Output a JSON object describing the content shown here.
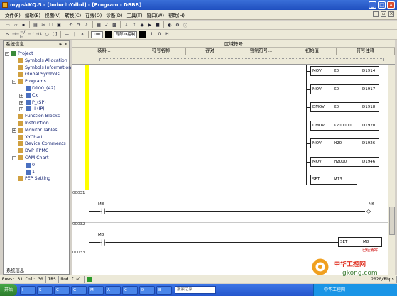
{
  "window": {
    "title": "mypskKQ.5 - [Indurlt-Ydbd] - [Program - DBBB]"
  },
  "menu": [
    "文件(F)",
    "编辑(E)",
    "视图(V)",
    "转换(C)",
    "在线(O)",
    "诊断(D)",
    "工具(T)",
    "窗口(W)",
    "帮助(H)"
  ],
  "toolbar": {
    "address_field": "100",
    "mode_label": "背部ID控制",
    "num_a": "1",
    "num_b": "0",
    "num_c": "H"
  },
  "panel": {
    "title": "系统信息",
    "tree": [
      {
        "label": "Project",
        "level": 0,
        "exp": "-"
      },
      {
        "label": "Symbols Allocation",
        "level": 1
      },
      {
        "label": "Symbols Information",
        "level": 1
      },
      {
        "label": "Global Symbols",
        "level": 1
      },
      {
        "label": "Programs",
        "level": 1,
        "exp": "-"
      },
      {
        "label": "D100_(42)",
        "level": 2
      },
      {
        "label": "Cx",
        "level": 2,
        "exp": "+"
      },
      {
        "label": "P_(SP)",
        "level": 2,
        "exp": "+"
      },
      {
        "label": "_I (IP)",
        "level": 2,
        "exp": "+"
      },
      {
        "label": "Function Blocks",
        "level": 1
      },
      {
        "label": "Instruction",
        "level": 1
      },
      {
        "label": "Monitor Tables",
        "level": 1,
        "exp": "+"
      },
      {
        "label": "XYChart",
        "level": 1
      },
      {
        "label": "Device Comments",
        "level": 1
      },
      {
        "label": "DVP_FPMC",
        "level": 1
      },
      {
        "label": "CAM Chart",
        "level": 1,
        "exp": "-"
      },
      {
        "label": "0",
        "level": 2
      },
      {
        "label": "1",
        "level": 2
      },
      {
        "label": "PEP Setting",
        "level": 1
      }
    ],
    "footer": "系统信息"
  },
  "grid": {
    "header": "区域符号",
    "columns": [
      "装料...",
      "符号名称",
      "存对",
      "强制符号...",
      "初始值",
      "符号注释"
    ]
  },
  "ladder": {
    "instructions": [
      {
        "op": "MOV",
        "src": "K0",
        "dst": "D1914"
      },
      {
        "op": "MOV",
        "src": "K0",
        "dst": "D1917"
      },
      {
        "op": "DMOV",
        "src": "K0",
        "dst": "D1918"
      },
      {
        "op": "DMOV",
        "src": "K200000",
        "dst": "D1920"
      },
      {
        "op": "MOV",
        "src": "H20",
        "dst": "D1926"
      },
      {
        "op": "MOV",
        "src": "H2000",
        "dst": "D1946"
      },
      {
        "op": "SET",
        "src": "M13",
        "dst": ""
      }
    ],
    "rungs": [
      {
        "number": "00031",
        "contact": "M8",
        "coil": "M6"
      },
      {
        "number": "00032",
        "contact": "M8",
        "output_op": "SET",
        "output_dev": "M8",
        "output_comment": "已经清零"
      },
      {
        "number": "00033"
      }
    ]
  },
  "status": {
    "cell1": "Rows: 31 Col: 30",
    "cell2": "IRS",
    "cell3": "Modifiel",
    "cell4": "2020/Rbps"
  },
  "taskbar": {
    "start": "开始",
    "tasks": [
      "I",
      "S",
      "C",
      "G",
      "M",
      "A",
      "C",
      "D",
      "B"
    ],
    "search": "搜索之家",
    "tray": "中华工控网"
  },
  "watermark": {
    "text": "中华工控网",
    "domain": "gkong.com"
  }
}
